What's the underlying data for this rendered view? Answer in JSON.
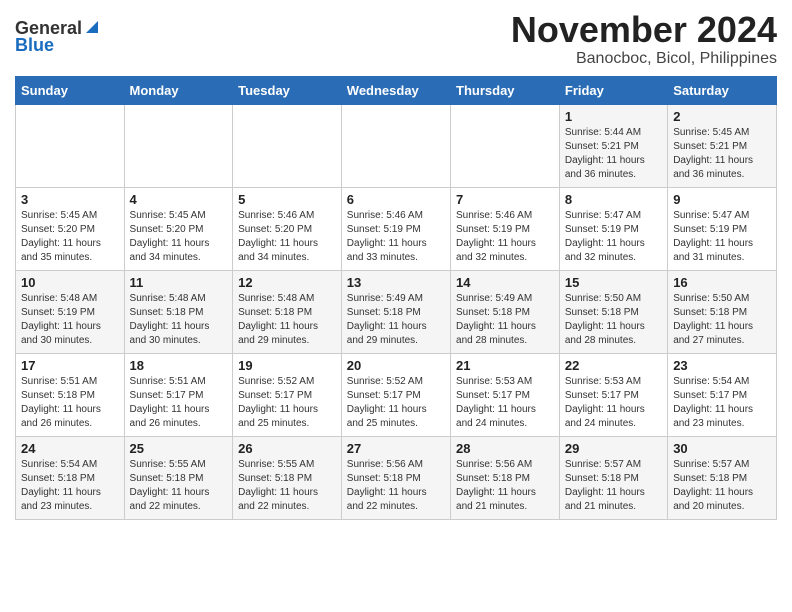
{
  "header": {
    "logo_line1": "General",
    "logo_line2": "Blue",
    "title": "November 2024",
    "subtitle": "Banocboc, Bicol, Philippines"
  },
  "calendar": {
    "headers": [
      "Sunday",
      "Monday",
      "Tuesday",
      "Wednesday",
      "Thursday",
      "Friday",
      "Saturday"
    ],
    "weeks": [
      [
        {
          "day": "",
          "info": ""
        },
        {
          "day": "",
          "info": ""
        },
        {
          "day": "",
          "info": ""
        },
        {
          "day": "",
          "info": ""
        },
        {
          "day": "",
          "info": ""
        },
        {
          "day": "1",
          "info": "Sunrise: 5:44 AM\nSunset: 5:21 PM\nDaylight: 11 hours\nand 36 minutes."
        },
        {
          "day": "2",
          "info": "Sunrise: 5:45 AM\nSunset: 5:21 PM\nDaylight: 11 hours\nand 36 minutes."
        }
      ],
      [
        {
          "day": "3",
          "info": "Sunrise: 5:45 AM\nSunset: 5:20 PM\nDaylight: 11 hours\nand 35 minutes."
        },
        {
          "day": "4",
          "info": "Sunrise: 5:45 AM\nSunset: 5:20 PM\nDaylight: 11 hours\nand 34 minutes."
        },
        {
          "day": "5",
          "info": "Sunrise: 5:46 AM\nSunset: 5:20 PM\nDaylight: 11 hours\nand 34 minutes."
        },
        {
          "day": "6",
          "info": "Sunrise: 5:46 AM\nSunset: 5:19 PM\nDaylight: 11 hours\nand 33 minutes."
        },
        {
          "day": "7",
          "info": "Sunrise: 5:46 AM\nSunset: 5:19 PM\nDaylight: 11 hours\nand 32 minutes."
        },
        {
          "day": "8",
          "info": "Sunrise: 5:47 AM\nSunset: 5:19 PM\nDaylight: 11 hours\nand 32 minutes."
        },
        {
          "day": "9",
          "info": "Sunrise: 5:47 AM\nSunset: 5:19 PM\nDaylight: 11 hours\nand 31 minutes."
        }
      ],
      [
        {
          "day": "10",
          "info": "Sunrise: 5:48 AM\nSunset: 5:19 PM\nDaylight: 11 hours\nand 30 minutes."
        },
        {
          "day": "11",
          "info": "Sunrise: 5:48 AM\nSunset: 5:18 PM\nDaylight: 11 hours\nand 30 minutes."
        },
        {
          "day": "12",
          "info": "Sunrise: 5:48 AM\nSunset: 5:18 PM\nDaylight: 11 hours\nand 29 minutes."
        },
        {
          "day": "13",
          "info": "Sunrise: 5:49 AM\nSunset: 5:18 PM\nDaylight: 11 hours\nand 29 minutes."
        },
        {
          "day": "14",
          "info": "Sunrise: 5:49 AM\nSunset: 5:18 PM\nDaylight: 11 hours\nand 28 minutes."
        },
        {
          "day": "15",
          "info": "Sunrise: 5:50 AM\nSunset: 5:18 PM\nDaylight: 11 hours\nand 28 minutes."
        },
        {
          "day": "16",
          "info": "Sunrise: 5:50 AM\nSunset: 5:18 PM\nDaylight: 11 hours\nand 27 minutes."
        }
      ],
      [
        {
          "day": "17",
          "info": "Sunrise: 5:51 AM\nSunset: 5:18 PM\nDaylight: 11 hours\nand 26 minutes."
        },
        {
          "day": "18",
          "info": "Sunrise: 5:51 AM\nSunset: 5:17 PM\nDaylight: 11 hours\nand 26 minutes."
        },
        {
          "day": "19",
          "info": "Sunrise: 5:52 AM\nSunset: 5:17 PM\nDaylight: 11 hours\nand 25 minutes."
        },
        {
          "day": "20",
          "info": "Sunrise: 5:52 AM\nSunset: 5:17 PM\nDaylight: 11 hours\nand 25 minutes."
        },
        {
          "day": "21",
          "info": "Sunrise: 5:53 AM\nSunset: 5:17 PM\nDaylight: 11 hours\nand 24 minutes."
        },
        {
          "day": "22",
          "info": "Sunrise: 5:53 AM\nSunset: 5:17 PM\nDaylight: 11 hours\nand 24 minutes."
        },
        {
          "day": "23",
          "info": "Sunrise: 5:54 AM\nSunset: 5:17 PM\nDaylight: 11 hours\nand 23 minutes."
        }
      ],
      [
        {
          "day": "24",
          "info": "Sunrise: 5:54 AM\nSunset: 5:18 PM\nDaylight: 11 hours\nand 23 minutes."
        },
        {
          "day": "25",
          "info": "Sunrise: 5:55 AM\nSunset: 5:18 PM\nDaylight: 11 hours\nand 22 minutes."
        },
        {
          "day": "26",
          "info": "Sunrise: 5:55 AM\nSunset: 5:18 PM\nDaylight: 11 hours\nand 22 minutes."
        },
        {
          "day": "27",
          "info": "Sunrise: 5:56 AM\nSunset: 5:18 PM\nDaylight: 11 hours\nand 22 minutes."
        },
        {
          "day": "28",
          "info": "Sunrise: 5:56 AM\nSunset: 5:18 PM\nDaylight: 11 hours\nand 21 minutes."
        },
        {
          "day": "29",
          "info": "Sunrise: 5:57 AM\nSunset: 5:18 PM\nDaylight: 11 hours\nand 21 minutes."
        },
        {
          "day": "30",
          "info": "Sunrise: 5:57 AM\nSunset: 5:18 PM\nDaylight: 11 hours\nand 20 minutes."
        }
      ]
    ]
  }
}
